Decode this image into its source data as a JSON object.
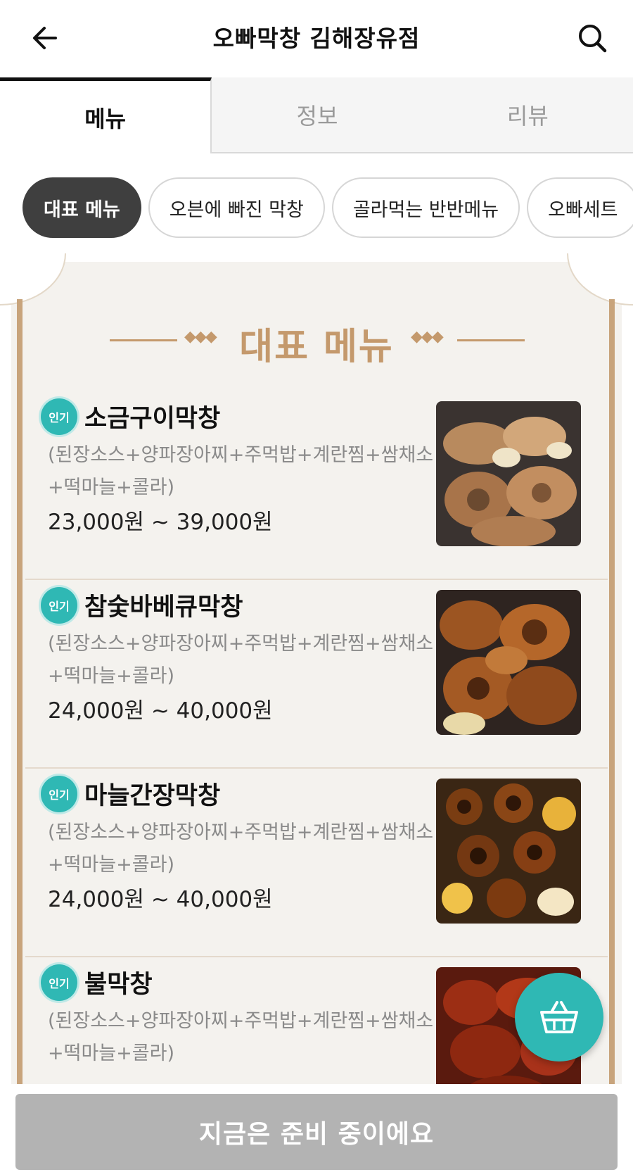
{
  "header": {
    "title": "오빠막창 김해장유점",
    "back_icon": "arrow-left-icon",
    "search_icon": "search-icon"
  },
  "tabs": [
    {
      "label": "메뉴",
      "active": true
    },
    {
      "label": "정보",
      "active": false
    },
    {
      "label": "리뷰",
      "active": false
    }
  ],
  "categories": [
    {
      "label": "대표 메뉴",
      "active": true
    },
    {
      "label": "오븐에 빠진 막창",
      "active": false
    },
    {
      "label": "골라먹는 반반메뉴",
      "active": false
    },
    {
      "label": "오빠세트",
      "active": false
    }
  ],
  "section": {
    "title": "대표 메뉴"
  },
  "menu_items": [
    {
      "badge": "인기",
      "name": "소금구이막창",
      "description": "(된장소스+양파장아찌+주먹밥+계란찜+쌈채소+떡마늘+콜라)",
      "price": "23,000원 ~ 39,000원"
    },
    {
      "badge": "인기",
      "name": "참숯바베큐막창",
      "description": "(된장소스+양파장아찌+주먹밥+계란찜+쌈채소+떡마늘+콜라)",
      "price": "24,000원 ~ 40,000원"
    },
    {
      "badge": "인기",
      "name": "마늘간장막창",
      "description": "(된장소스+양파장아찌+주먹밥+계란찜+쌈채소+떡마늘+콜라)",
      "price": "24,000원 ~ 40,000원"
    },
    {
      "badge": "인기",
      "name": "불막창",
      "description": "(된장소스+양파장아찌+주먹밥+계란찜+쌈채소+떡마늘+콜라)",
      "price": ""
    }
  ],
  "cart": {
    "icon": "basket-icon"
  },
  "bottom_bar": {
    "label": "지금은 준비 중이에요"
  },
  "colors": {
    "accent_teal": "#2fb8b4",
    "gold": "#c4996c",
    "chip_active": "#3f3f3f",
    "disabled": "#b3b3b3"
  }
}
